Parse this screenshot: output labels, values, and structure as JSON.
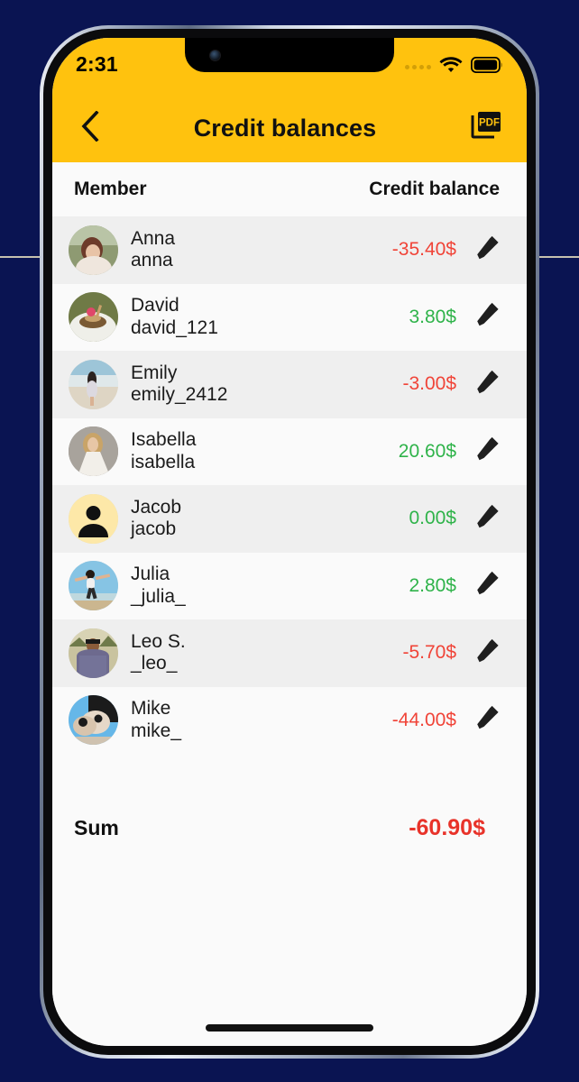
{
  "status_bar": {
    "time": "2:31",
    "cellular_icon": "signal-dots-icon",
    "wifi_icon": "wifi-icon",
    "battery_icon": "battery-full-icon"
  },
  "app_bar": {
    "back_icon": "chevron-left-icon",
    "title": "Credit balances",
    "pdf_icon": "pdf-export-icon",
    "accent_color": "#ffc20e"
  },
  "table": {
    "columns": [
      "Member",
      "Credit balance"
    ],
    "rows": [
      {
        "name": "Anna",
        "username": "anna",
        "amount": "-35.40$",
        "sign": "neg",
        "avatar": "photo-anna",
        "edit_icon": "pencil-icon"
      },
      {
        "name": "David",
        "username": "david_121",
        "amount": "3.80$",
        "sign": "pos",
        "avatar": "photo-david",
        "edit_icon": "pencil-icon"
      },
      {
        "name": "Emily",
        "username": "emily_2412",
        "amount": "-3.00$",
        "sign": "neg",
        "avatar": "photo-emily",
        "edit_icon": "pencil-icon"
      },
      {
        "name": "Isabella",
        "username": "isabella",
        "amount": "20.60$",
        "sign": "pos",
        "avatar": "photo-isabella",
        "edit_icon": "pencil-icon"
      },
      {
        "name": "Jacob",
        "username": "jacob",
        "amount": "0.00$",
        "sign": "pos",
        "avatar": "placeholder-person",
        "edit_icon": "pencil-icon"
      },
      {
        "name": "Julia",
        "username": "_julia_",
        "amount": "2.80$",
        "sign": "pos",
        "avatar": "photo-julia",
        "edit_icon": "pencil-icon"
      },
      {
        "name": "Leo S.",
        "username": "_leo_",
        "amount": "-5.70$",
        "sign": "neg",
        "avatar": "photo-leo",
        "edit_icon": "pencil-icon"
      },
      {
        "name": "Mike",
        "username": "mike_",
        "amount": "-44.00$",
        "sign": "neg",
        "avatar": "photo-mike",
        "edit_icon": "pencil-icon"
      }
    ]
  },
  "summary": {
    "label": "Sum",
    "value": "-60.90$",
    "value_color": "#e8332a"
  },
  "colors": {
    "positive": "#2fb34a",
    "negative": "#f04438",
    "row_odd": "#efefef",
    "row_even": "#fafafa",
    "backdrop": "#0a1452"
  }
}
